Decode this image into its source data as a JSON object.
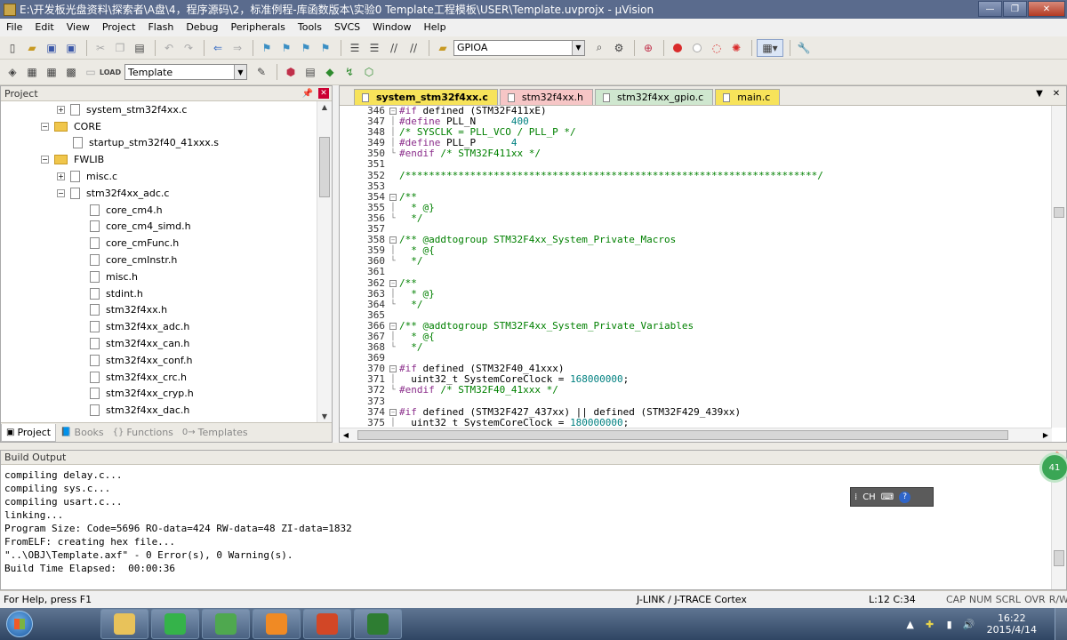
{
  "window": {
    "title": "E:\\开发板光盘资料\\探索者\\A盘\\4，程序源码\\2，标准例程-库函数版本\\实验0 Template工程模板\\USER\\Template.uvprojx - µVision",
    "minimize": "—",
    "maximize": "❐",
    "close": "✕"
  },
  "menu": [
    "File",
    "Edit",
    "View",
    "Project",
    "Flash",
    "Debug",
    "Peripherals",
    "Tools",
    "SVCS",
    "Window",
    "Help"
  ],
  "toolbar1": {
    "find_combo": "GPIOA"
  },
  "toolbar2": {
    "target_combo": "Template"
  },
  "project_panel": {
    "title": "Project",
    "tree": [
      {
        "indent": 63,
        "expander": "+",
        "icon": "file",
        "label": "system_stm32f4xx.c"
      },
      {
        "indent": 45,
        "expander": "−",
        "icon": "folder",
        "label": "CORE"
      },
      {
        "indent": 81,
        "expander": "",
        "icon": "file",
        "label": "startup_stm32f40_41xxx.s"
      },
      {
        "indent": 45,
        "expander": "−",
        "icon": "folder",
        "label": "FWLIB"
      },
      {
        "indent": 63,
        "expander": "+",
        "icon": "file",
        "label": "misc.c"
      },
      {
        "indent": 63,
        "expander": "−",
        "icon": "file",
        "label": "stm32f4xx_adc.c"
      },
      {
        "indent": 100,
        "expander": "",
        "icon": "file",
        "label": "core_cm4.h"
      },
      {
        "indent": 100,
        "expander": "",
        "icon": "file",
        "label": "core_cm4_simd.h"
      },
      {
        "indent": 100,
        "expander": "",
        "icon": "file",
        "label": "core_cmFunc.h"
      },
      {
        "indent": 100,
        "expander": "",
        "icon": "file",
        "label": "core_cmInstr.h"
      },
      {
        "indent": 100,
        "expander": "",
        "icon": "file",
        "label": "misc.h"
      },
      {
        "indent": 100,
        "expander": "",
        "icon": "file",
        "label": "stdint.h"
      },
      {
        "indent": 100,
        "expander": "",
        "icon": "file",
        "label": "stm32f4xx.h"
      },
      {
        "indent": 100,
        "expander": "",
        "icon": "file",
        "label": "stm32f4xx_adc.h"
      },
      {
        "indent": 100,
        "expander": "",
        "icon": "file",
        "label": "stm32f4xx_can.h"
      },
      {
        "indent": 100,
        "expander": "",
        "icon": "file",
        "label": "stm32f4xx_conf.h"
      },
      {
        "indent": 100,
        "expander": "",
        "icon": "file",
        "label": "stm32f4xx_crc.h"
      },
      {
        "indent": 100,
        "expander": "",
        "icon": "file",
        "label": "stm32f4xx_cryp.h"
      },
      {
        "indent": 100,
        "expander": "",
        "icon": "file",
        "label": "stm32f4xx_dac.h"
      }
    ],
    "tabs": [
      {
        "icon": "▣",
        "label": "Project",
        "active": true
      },
      {
        "icon": "📘",
        "label": "Books",
        "active": false
      },
      {
        "icon": "{}",
        "label": "Functions",
        "active": false
      },
      {
        "icon": "0→",
        "label": "Templates",
        "active": false
      }
    ]
  },
  "editor": {
    "tabs": [
      {
        "label": "system_stm32f4xx.c",
        "color": "#f7e35a",
        "active": true
      },
      {
        "label": "stm32f4xx.h",
        "color": "#f6c6c6",
        "active": false
      },
      {
        "label": "stm32f4xx_gpio.c",
        "color": "#cfe7cf",
        "active": false
      },
      {
        "label": "main.c",
        "color": "#f7e35a",
        "active": false
      }
    ],
    "lines": [
      {
        "n": "346",
        "fold": "−",
        "segs": [
          [
            "#if",
            "#8b2e8b"
          ],
          [
            " defined (STM32F411xE)",
            "#000"
          ]
        ]
      },
      {
        "n": "347",
        "fold": "│",
        "segs": [
          [
            "#define",
            "#8b2e8b"
          ],
          [
            " PLL_N      ",
            "#000"
          ],
          [
            "400",
            "#008080"
          ]
        ]
      },
      {
        "n": "348",
        "fold": "│",
        "segs": [
          [
            "/* SYSCLK = PLL_VCO / PLL_P */",
            "#008000"
          ]
        ]
      },
      {
        "n": "349",
        "fold": "│",
        "segs": [
          [
            "#define",
            "#8b2e8b"
          ],
          [
            " PLL_P      ",
            "#000"
          ],
          [
            "4",
            "#008080"
          ]
        ]
      },
      {
        "n": "350",
        "fold": "└",
        "segs": [
          [
            "#endif",
            "#8b2e8b"
          ],
          [
            " ",
            "#000"
          ],
          [
            "/* STM32F411xx */",
            "#008000"
          ]
        ]
      },
      {
        "n": "351",
        "fold": "",
        "segs": [
          [
            "",
            "#000"
          ]
        ]
      },
      {
        "n": "352",
        "fold": "",
        "segs": [
          [
            "/**********************************************************************/",
            "#008000"
          ]
        ]
      },
      {
        "n": "353",
        "fold": "",
        "segs": [
          [
            "",
            "#000"
          ]
        ]
      },
      {
        "n": "354",
        "fold": "−",
        "segs": [
          [
            "/**",
            "#008000"
          ]
        ]
      },
      {
        "n": "355",
        "fold": "│",
        "segs": [
          [
            "  * @}",
            "#008000"
          ]
        ]
      },
      {
        "n": "356",
        "fold": "└",
        "segs": [
          [
            "  */",
            "#008000"
          ]
        ]
      },
      {
        "n": "357",
        "fold": "",
        "segs": [
          [
            "",
            "#000"
          ]
        ]
      },
      {
        "n": "358",
        "fold": "−",
        "segs": [
          [
            "/** @addtogroup STM32F4xx_System_Private_Macros",
            "#008000"
          ]
        ]
      },
      {
        "n": "359",
        "fold": "│",
        "segs": [
          [
            "  * @{",
            "#008000"
          ]
        ]
      },
      {
        "n": "360",
        "fold": "└",
        "segs": [
          [
            "  */",
            "#008000"
          ]
        ]
      },
      {
        "n": "361",
        "fold": "",
        "segs": [
          [
            "",
            "#000"
          ]
        ]
      },
      {
        "n": "362",
        "fold": "−",
        "segs": [
          [
            "/**",
            "#008000"
          ]
        ]
      },
      {
        "n": "363",
        "fold": "│",
        "segs": [
          [
            "  * @}",
            "#008000"
          ]
        ]
      },
      {
        "n": "364",
        "fold": "└",
        "segs": [
          [
            "  */",
            "#008000"
          ]
        ]
      },
      {
        "n": "365",
        "fold": "",
        "segs": [
          [
            "",
            "#000"
          ]
        ]
      },
      {
        "n": "366",
        "fold": "−",
        "segs": [
          [
            "/** @addtogroup STM32F4xx_System_Private_Variables",
            "#008000"
          ]
        ]
      },
      {
        "n": "367",
        "fold": "│",
        "segs": [
          [
            "  * @{",
            "#008000"
          ]
        ]
      },
      {
        "n": "368",
        "fold": "└",
        "segs": [
          [
            "  */",
            "#008000"
          ]
        ]
      },
      {
        "n": "369",
        "fold": "",
        "segs": [
          [
            "",
            "#000"
          ]
        ]
      },
      {
        "n": "370",
        "fold": "−",
        "segs": [
          [
            "#if",
            "#8b2e8b"
          ],
          [
            " defined (STM32F40_41xxx)",
            "#000"
          ]
        ]
      },
      {
        "n": "371",
        "fold": "│",
        "segs": [
          [
            "  uint32_t SystemCoreClock = ",
            "#000"
          ],
          [
            "168000000",
            "#008080"
          ],
          [
            ";",
            "#000"
          ]
        ]
      },
      {
        "n": "372",
        "fold": "└",
        "segs": [
          [
            "#endif",
            "#8b2e8b"
          ],
          [
            " ",
            "#000"
          ],
          [
            "/* STM32F40_41xxx */",
            "#008000"
          ]
        ]
      },
      {
        "n": "373",
        "fold": "",
        "segs": [
          [
            "",
            "#000"
          ]
        ]
      },
      {
        "n": "374",
        "fold": "−",
        "segs": [
          [
            "#if",
            "#8b2e8b"
          ],
          [
            " defined (STM32F427_437xx) || defined (STM32F429_439xx)",
            "#000"
          ]
        ]
      },
      {
        "n": "375",
        "fold": "│",
        "segs": [
          [
            "  uint32_t SystemCoreClock = ",
            "#000"
          ],
          [
            "180000000",
            "#008080"
          ],
          [
            ";",
            "#000"
          ]
        ]
      }
    ]
  },
  "build_output": {
    "title": "Build Output",
    "lines": [
      "compiling delay.c...",
      "compiling sys.c...",
      "compiling usart.c...",
      "linking...",
      "Program Size: Code=5696 RO-data=424 RW-data=48 ZI-data=1832",
      "FromELF: creating hex file...",
      "\"..\\OBJ\\Template.axf\" - 0 Error(s), 0 Warning(s).",
      "Build Time Elapsed:  00:00:36"
    ],
    "ime": {
      "lang": "CH",
      "kb": "⌨",
      "help": "?"
    },
    "badge": "41"
  },
  "status": {
    "help": "For Help, press F1",
    "debugger": "J-LINK / J-TRACE Cortex",
    "position": "L:12 C:34",
    "flags": [
      "CAP",
      "NUM",
      "SCRL",
      "OVR",
      "R/W"
    ]
  },
  "taskbar": {
    "apps": [
      {
        "name": "explorer",
        "color": "#e8c25a"
      },
      {
        "name": "refresh-app",
        "color": "#35b34a"
      },
      {
        "name": "qt-app",
        "color": "#4fa84f"
      },
      {
        "name": "pdf-app",
        "color": "#f08a24"
      },
      {
        "name": "powerpoint",
        "color": "#d24726"
      },
      {
        "name": "keil-v5",
        "color": "#2e7d32"
      }
    ],
    "time": "16:22",
    "date": "2015/4/14"
  }
}
